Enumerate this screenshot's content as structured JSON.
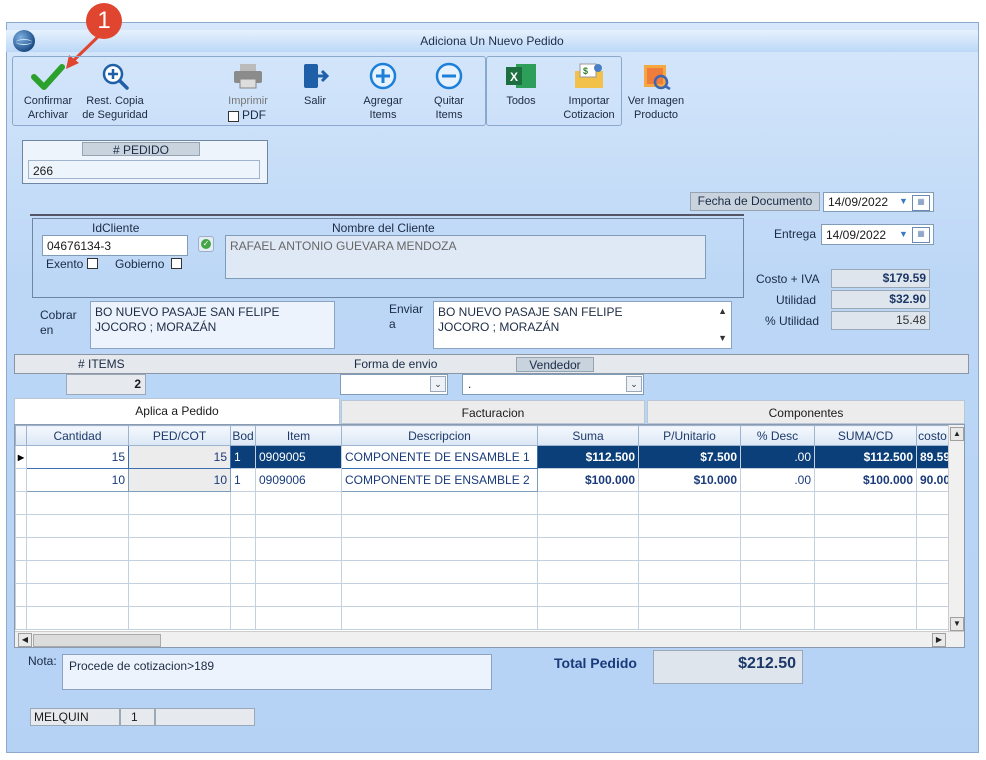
{
  "badge": "1",
  "window": {
    "title": "Adiciona Un Nuevo Pedido"
  },
  "toolbar": {
    "confirm": [
      "Confirmar",
      "Archivar"
    ],
    "restore": [
      "Rest. Copia",
      "de Seguridad"
    ],
    "print": "Imprimir",
    "pdf": "PDF",
    "exit": "Salir",
    "add": [
      "Agregar",
      "Items"
    ],
    "remove": [
      "Quitar",
      "Items"
    ],
    "all": "Todos",
    "import": [
      "Importar",
      "Cotizacion"
    ],
    "image": [
      "Ver Imagen",
      "Producto"
    ]
  },
  "pedido": {
    "label": "# PEDIDO",
    "value": "266"
  },
  "fecha_documento": {
    "label": "Fecha de  Documento",
    "value": "14/09/2022"
  },
  "cliente": {
    "id_label": "IdCliente",
    "id_value": "04676134-3",
    "name_label": "Nombre del Cliente",
    "name_value": "RAFAEL ANTONIO GUEVARA MENDOZA",
    "exento": "Exento",
    "gobierno": "Gobierno"
  },
  "entrega": {
    "label": "Entrega",
    "value": "14/09/2022"
  },
  "costos": {
    "costo_iva_label": "Costo + IVA",
    "costo_iva": "$179.59",
    "utilidad_label": "Utilidad",
    "utilidad": "$32.90",
    "pct_utilidad_label": "% Utilidad",
    "pct_utilidad": "15.48"
  },
  "cobrar": {
    "label": [
      "Cobrar",
      "en"
    ],
    "lines": [
      "BO NUEVO PASAJE SAN FELIPE",
      "JOCORO ; MORAZÁN"
    ]
  },
  "enviar": {
    "label": [
      "Enviar",
      "a"
    ],
    "lines": [
      "BO NUEVO PASAJE SAN FELIPE",
      "JOCORO ; MORAZÁN"
    ]
  },
  "items_bar": {
    "items_label": "# ITEMS",
    "items_value": "2",
    "forma_envio": "Forma de envio",
    "vendedor": "Vendedor",
    "vendedor_value": "."
  },
  "tabs": [
    "Aplica a Pedido",
    "Facturacion",
    "Componentes"
  ],
  "grid": {
    "columns": [
      "Cantidad",
      "PED/COT",
      "Bod",
      "Item",
      "Descripcion",
      "Suma",
      "P/Unitario",
      "% Desc",
      "SUMA/CD",
      "costo"
    ],
    "rows": [
      [
        "15",
        "15",
        "1",
        "0909005",
        "COMPONENTE DE ENSAMBLE 1",
        "$112.500",
        "$7.500",
        ".00",
        "$112.500",
        "89.59"
      ],
      [
        "10",
        "10",
        "1",
        "0909006",
        "COMPONENTE DE ENSAMBLE 2",
        "$100.000",
        "$10.000",
        ".00",
        "$100.000",
        "90.00"
      ]
    ]
  },
  "nota": {
    "label": "Nota:",
    "value": "Procede de cotizacion>189"
  },
  "total": {
    "label": "Total Pedido",
    "value": "$212.50"
  },
  "status": {
    "user": "MELQUIN",
    "num": "1"
  }
}
